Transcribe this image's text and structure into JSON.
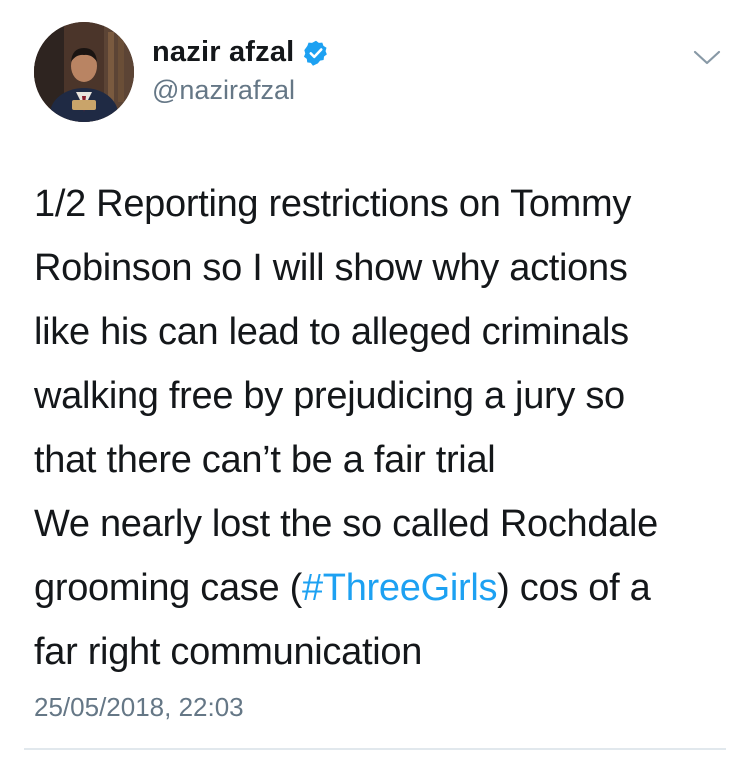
{
  "author": {
    "display_name": "nazir afzal",
    "handle": "@nazirafzal",
    "verified": true,
    "avatar_icon": "profile-photo"
  },
  "menu": {
    "icon": "chevron-down-icon"
  },
  "tweet": {
    "lines": [
      "1/2 Reporting restrictions on Tommy",
      "Robinson so I will show why actions",
      "like his can lead to alleged criminals",
      "walking free by prejudicing a jury so",
      "that there can’t be a fair trial",
      "We nearly lost the so called Rochdale"
    ],
    "line7_before": "grooming case (",
    "hashtag": "#ThreeGirls",
    "line7_after": ") cos of a",
    "line8": "far right communication",
    "timestamp": "25/05/2018, 22:03"
  },
  "colors": {
    "hashtag": "#1da1f2",
    "verified_badge": "#1da1f2",
    "secondary_text": "#657786",
    "divider": "#e1e8ed"
  }
}
